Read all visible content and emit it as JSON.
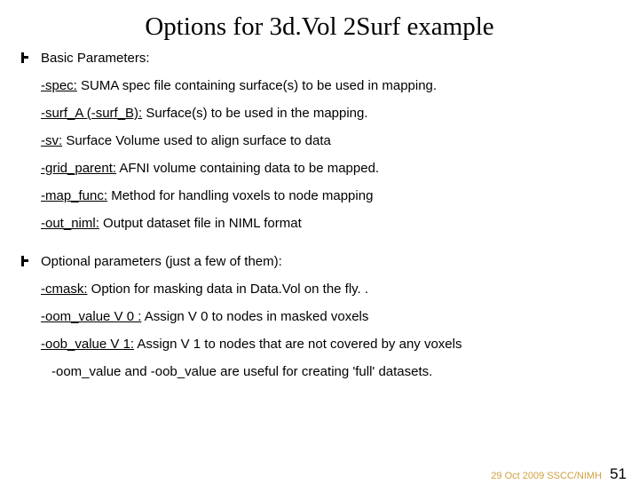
{
  "title": "Options for 3d.Vol 2Surf example",
  "section1": {
    "heading": "Basic Parameters:",
    "items": [
      {
        "opt": "-spec:",
        "desc": " SUMA spec file containing surface(s) to be used in mapping."
      },
      {
        "opt": "-surf_A",
        "opt2": " (-surf_B):",
        "desc": " Surface(s) to be used in the mapping."
      },
      {
        "opt": "-sv:",
        "desc": " Surface Volume used to align surface to data"
      },
      {
        "opt": "-grid_parent:",
        "desc": " AFNI volume containing data to be mapped."
      },
      {
        "opt": "-map_func:",
        "desc": " Method for handling voxels to node mapping"
      },
      {
        "opt": "-out_niml:",
        "desc": " Output dataset file in NIML format"
      }
    ]
  },
  "section2": {
    "heading": "Optional parameters (just a few of them):",
    "items": [
      {
        "opt": "-cmask:",
        "desc": " Option for masking data in Data.Vol on the fly. ."
      },
      {
        "opt": "-oom_value V 0 :",
        "desc": " Assign V 0 to nodes in masked voxels"
      },
      {
        "opt": "-oob_value V 1:",
        "desc": " Assign V 1 to nodes that are not covered by any voxels"
      }
    ],
    "note": "-oom_value and -oob_value are useful for creating 'full' datasets."
  },
  "footer": {
    "date": "29 Oct 2009 SSCC/NIMH",
    "page": "51"
  }
}
